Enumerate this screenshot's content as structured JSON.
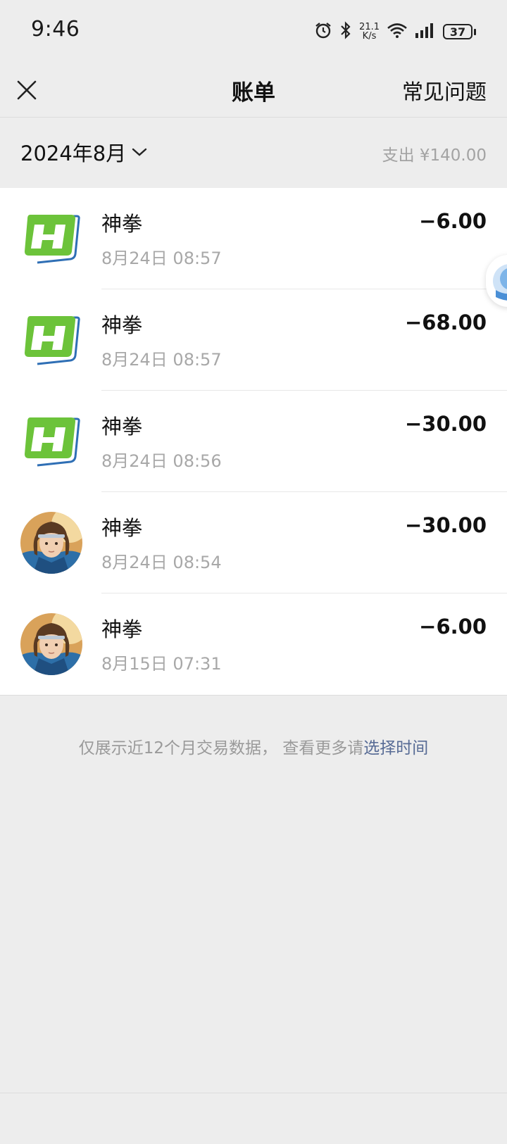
{
  "status_bar": {
    "time": "9:46",
    "net_speed_value": "21.1",
    "net_speed_unit": "K/s",
    "battery": "37"
  },
  "nav": {
    "title": "账单",
    "faq": "常见问题"
  },
  "filter": {
    "month": "2024年8月",
    "expense_total": "支出 ¥140.00"
  },
  "transactions": [
    {
      "name": "神拳",
      "time": "8月24日 08:57",
      "amount": "−6.00",
      "avatar": "h-logo-icon"
    },
    {
      "name": "神拳",
      "time": "8月24日 08:57",
      "amount": "−68.00",
      "avatar": "h-logo-icon"
    },
    {
      "name": "神拳",
      "time": "8月24日 08:56",
      "amount": "−30.00",
      "avatar": "h-logo-icon"
    },
    {
      "name": "神拳",
      "time": "8月24日 08:54",
      "amount": "−30.00",
      "avatar": "character-portrait"
    },
    {
      "name": "神拳",
      "time": "8月15日 07:31",
      "amount": "−6.00",
      "avatar": "character-portrait"
    }
  ],
  "footer": {
    "note": "仅展示近12个月交易数据， 查看更多请",
    "link": "选择时间"
  },
  "colors": {
    "background": "#ededed",
    "card": "#ffffff",
    "link": "#576b95",
    "h_logo_green": "#6cc33a",
    "h_logo_blue": "#2f6fb5"
  }
}
